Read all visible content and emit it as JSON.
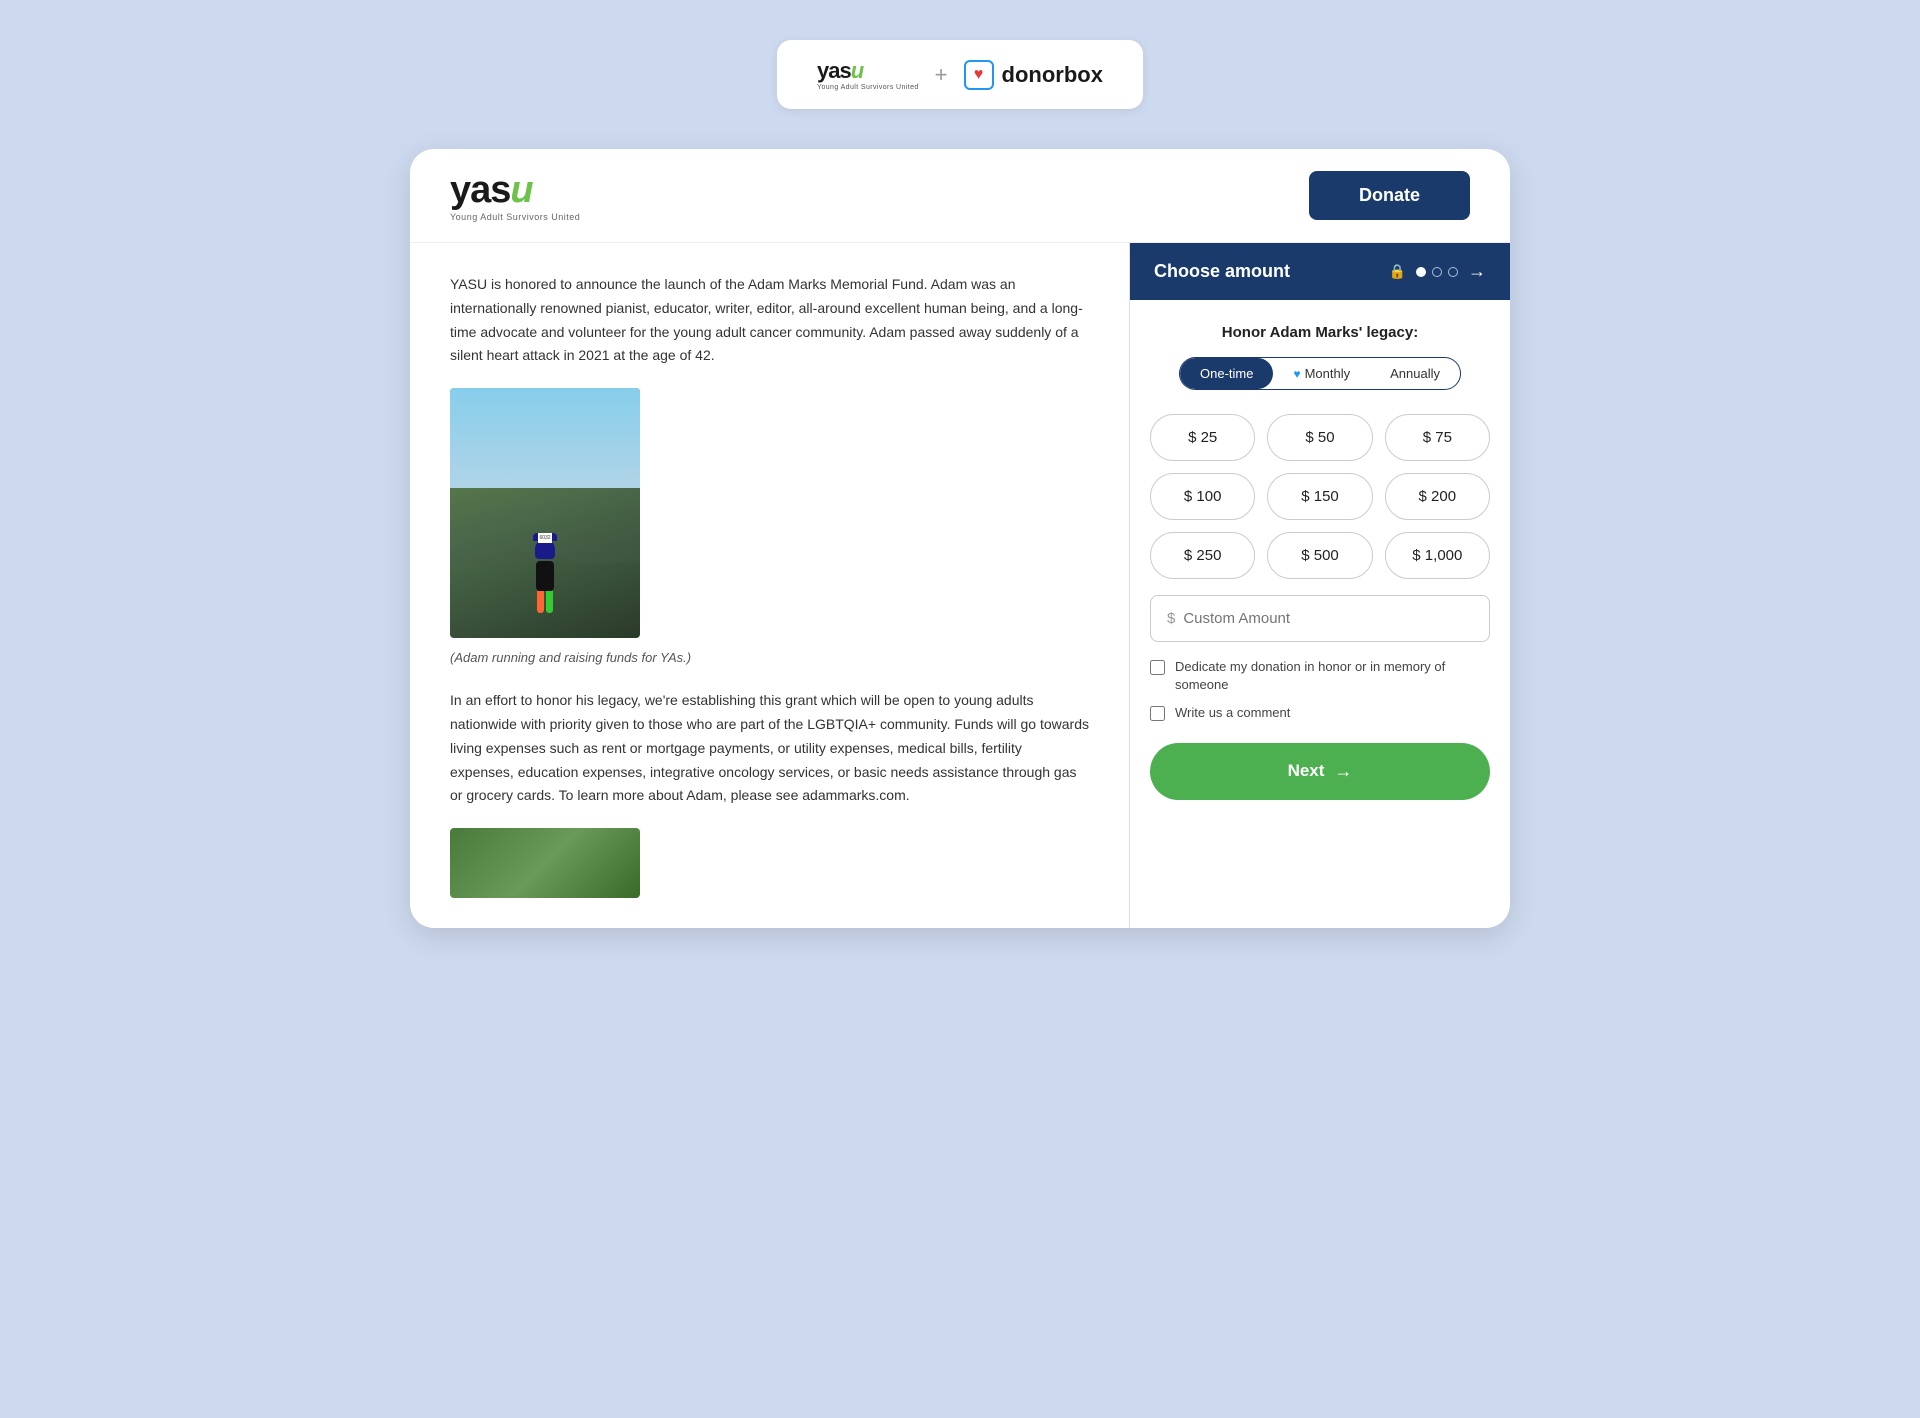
{
  "topBar": {
    "yasu": {
      "text": "yasu",
      "subtitle": "Young Adult Survivors United"
    },
    "plus": "+",
    "donorbox": {
      "icon": "♥",
      "text": "donorbox"
    }
  },
  "header": {
    "logo": {
      "text": "yasu",
      "subtitle": "Young Adult Survivors United"
    },
    "donateButton": "Donate"
  },
  "article": {
    "text1": "YASU is honored to announce the launch of the Adam Marks Memorial Fund. Adam was an internationally renowned pianist, educator, writer, editor, all-around excellent human being, and a long-time advocate and volunteer for the young adult cancer community. Adam passed away suddenly of a silent heart attack in 2021 at the age of 42.",
    "imageCaption": "(Adam running and raising funds for YAs.)",
    "text2": "In an effort to honor his legacy, we're establishing this grant which will be open to young adults nationwide with priority given to those who are part of the LGBTQIA+ community. Funds will go towards living expenses such as rent or mortgage payments, or utility expenses, medical bills, fertility expenses, education expenses, integrative oncology services, or basic needs assistance through gas or grocery cards. To learn more about Adam, please see adammarks.com."
  },
  "donationForm": {
    "headerTitle": "Choose amount",
    "lockIcon": "🔒",
    "steps": [
      {
        "filled": true
      },
      {
        "filled": false
      },
      {
        "filled": false
      }
    ],
    "arrowLabel": "→",
    "honorTitle": "Honor Adam Marks' legacy:",
    "frequencies": [
      {
        "id": "one-time",
        "label": "One-time",
        "active": true
      },
      {
        "id": "monthly",
        "label": "Monthly",
        "active": false,
        "heart": true
      },
      {
        "id": "annually",
        "label": "Annually",
        "active": false
      }
    ],
    "amounts": [
      {
        "value": "$ 25"
      },
      {
        "value": "$ 50"
      },
      {
        "value": "$ 75"
      },
      {
        "value": "$ 100"
      },
      {
        "value": "$ 150"
      },
      {
        "value": "$ 200"
      },
      {
        "value": "$ 250"
      },
      {
        "value": "$ 500"
      },
      {
        "value": "$ 1,000"
      }
    ],
    "customAmountPlaceholder": "Custom Amount",
    "dollarSign": "$",
    "checkboxes": [
      {
        "label": "Dedicate my donation in honor or in memory of someone"
      },
      {
        "label": "Write us a comment"
      }
    ],
    "nextButton": "Next",
    "nextArrow": "→"
  }
}
